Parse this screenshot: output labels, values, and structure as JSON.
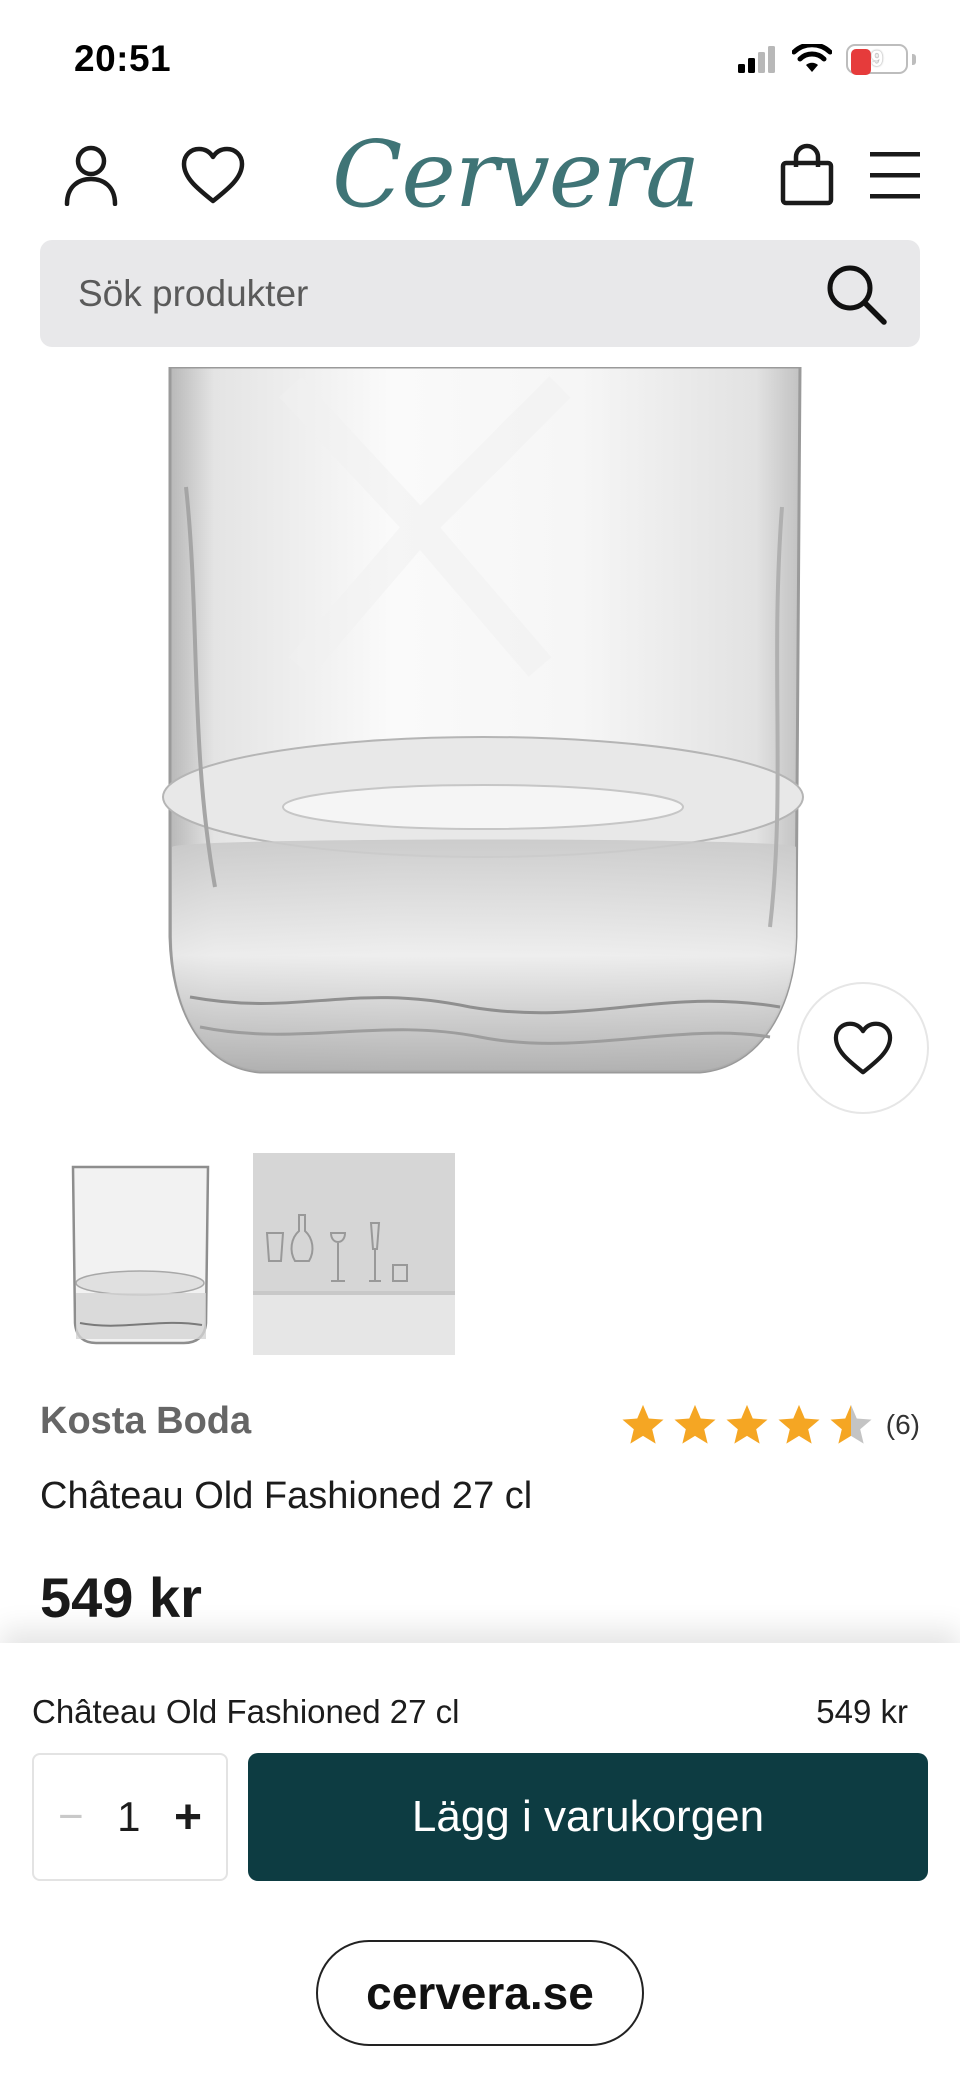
{
  "status_bar": {
    "time": "20:51",
    "battery": "9",
    "icons": [
      "cellular-signal-icon",
      "wifi-icon",
      "battery-icon"
    ]
  },
  "header": {
    "logo": "Cervera",
    "brand_color": "#3f7476",
    "icons": [
      "user-icon",
      "heart-icon",
      "shopping-bag-icon",
      "menu-icon"
    ]
  },
  "search": {
    "placeholder": "Sök produkter",
    "icon": "search-icon"
  },
  "product": {
    "brand": "Kosta Boda",
    "name": "Château Old Fashioned 27 cl",
    "price": "549 kr",
    "rating": 4.5,
    "rating_max": 5,
    "rating_count": "(6)",
    "star_color": "#f5a623",
    "thumbnails": [
      "glass-thumbnail",
      "collection-thumbnail"
    ]
  },
  "sticky_bar": {
    "name": "Château Old Fashioned 27 cl",
    "price": "549 kr",
    "quantity": "1",
    "minus": "−",
    "plus": "+",
    "add_to_cart": "Lägg i varukorgen",
    "button_color": "#0d3c42"
  },
  "browser": {
    "url": "cervera.se"
  }
}
